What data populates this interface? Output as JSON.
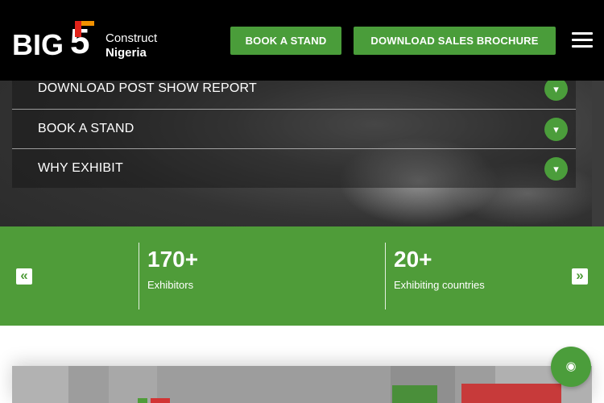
{
  "header": {
    "logo": {
      "text_big": "BIG",
      "text_five": "5",
      "text_construct": "Construct",
      "text_region": "Nigeria"
    },
    "book_stand_label": "BOOK A STAND",
    "brochure_label": "DOWNLOAD SALES BROCHURE",
    "menu_icon": "hamburger-icon"
  },
  "accordion": {
    "items": [
      {
        "label": "DOWNLOAD POST SHOW REPORT",
        "icon": "chevron-icon"
      },
      {
        "label": "BOOK A STAND",
        "icon": "chevron-icon"
      },
      {
        "label": "WHY EXHIBIT",
        "icon": "chevron-icon"
      }
    ]
  },
  "stats": {
    "prev_icon": "«",
    "next_icon": "»",
    "items": [
      {
        "value": "170+",
        "label": "Exhibitors"
      },
      {
        "value": "20+",
        "label": "Exhibiting countries"
      }
    ]
  },
  "colors": {
    "brand_green": "#4f9c39",
    "header_bg": "#000000",
    "logo_red": "#e2231a",
    "logo_orange": "#f39200"
  }
}
